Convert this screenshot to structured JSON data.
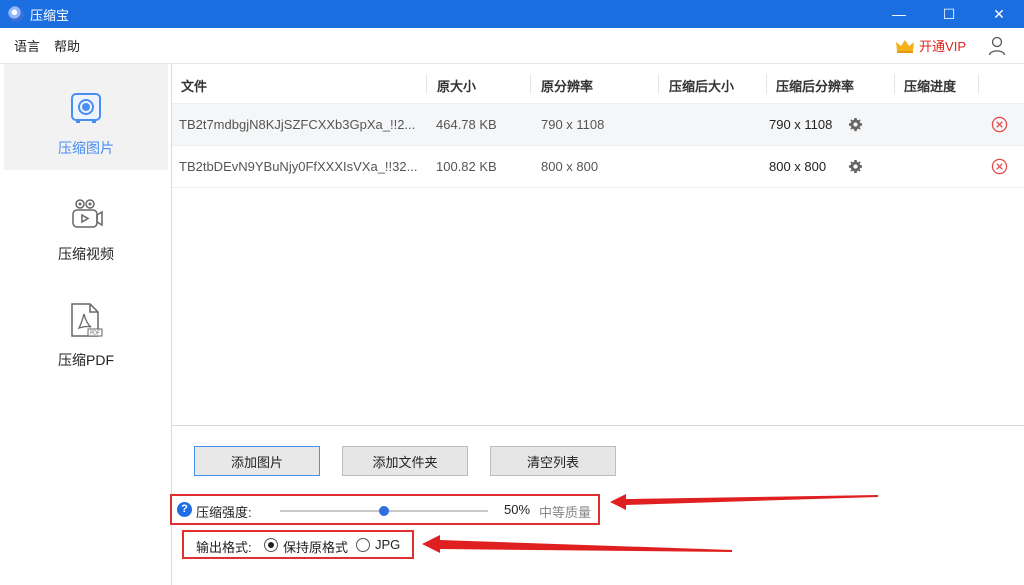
{
  "window": {
    "title": "压缩宝",
    "controls": {
      "minimize": "—",
      "maximize": "☐",
      "close": "✕"
    }
  },
  "menu": {
    "language": "语言",
    "help": "帮助",
    "vip": "开通VIP"
  },
  "sidebar": {
    "items": [
      {
        "label": "压缩图片",
        "icon": "camera-icon",
        "active": true
      },
      {
        "label": "压缩视频",
        "icon": "video-camera-icon",
        "active": false
      },
      {
        "label": "压缩PDF",
        "icon": "pdf-file-icon",
        "active": false
      }
    ]
  },
  "table": {
    "headers": [
      "文件",
      "原大小",
      "原分辨率",
      "压缩后大小",
      "压缩后分辨率",
      "压缩进度"
    ],
    "rows": [
      {
        "file": "TB2t7mdbgjN8KJjSZFCXXb3GpXa_!!2...",
        "orig_size": "464.78 KB",
        "orig_res": "790 x 1108",
        "new_size": "",
        "new_res": "790 x 1108",
        "progress": ""
      },
      {
        "file": "TB2tbDEvN9YBuNjy0FfXXXIsVXa_!!32...",
        "orig_size": "100.82 KB",
        "orig_res": "800 x 800",
        "new_size": "",
        "new_res": "800 x 800",
        "progress": ""
      }
    ]
  },
  "actions": {
    "add_image": "添加图片",
    "add_folder": "添加文件夹",
    "clear_list": "清空列表"
  },
  "compression": {
    "label": "压缩强度:",
    "value_percent": 50,
    "value_text": "50%",
    "quality": "中等质量",
    "help": "?"
  },
  "output_format": {
    "label": "输出格式:",
    "options": [
      "保持原格式",
      "JPG"
    ],
    "selected": "保持原格式"
  },
  "colors": {
    "titlebar": "#1a6ee0",
    "accent": "#4a8ef2",
    "highlight_box": "#e03030",
    "vip_text": "#e0231c"
  }
}
